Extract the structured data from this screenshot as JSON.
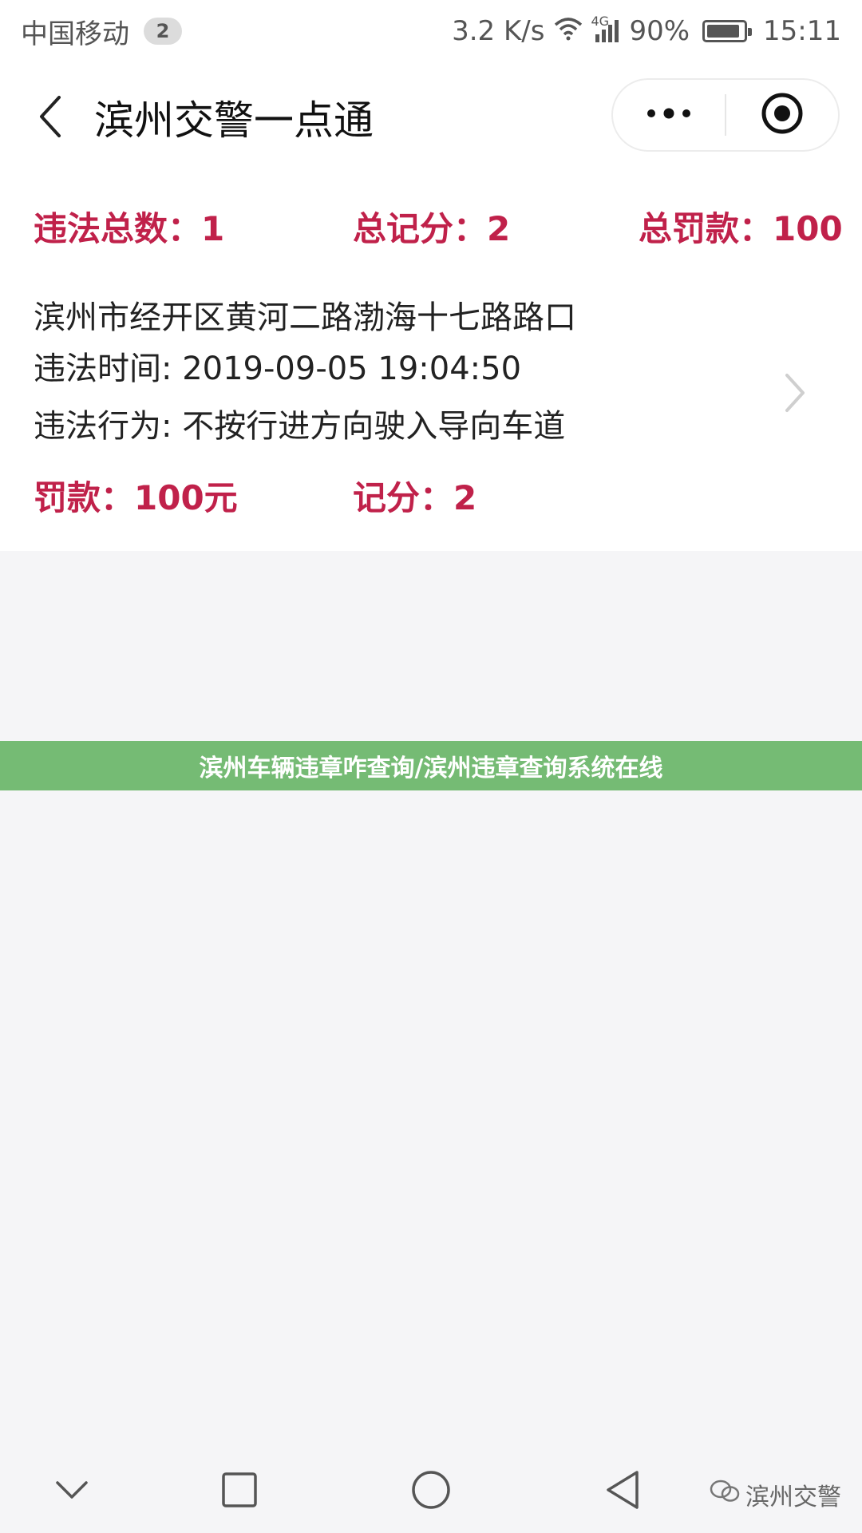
{
  "status_bar": {
    "carrier": "中国移动",
    "sim_badge": "2",
    "net_speed": "3.2 K/s",
    "network_type": "4G",
    "battery": "90%",
    "time": "15:11",
    "battery_level": 0.9
  },
  "header": {
    "title": "滨州交警一点通",
    "back_icon": "chevron-left-icon",
    "more_icon": "more-dots-icon",
    "close_icon": "target-close-icon"
  },
  "summary": {
    "total_violations": "违法总数：1",
    "total_points": "总记分：2",
    "total_fine": "总罚款：100"
  },
  "record": {
    "location": "滨州市经开区黄河二路渤海十七路路口",
    "time": "违法时间: 2019-09-05 19:04:50",
    "behavior": "违法行为: 不按行进方向驶入导向车道",
    "fine": "罚款：100元",
    "points": "记分：2"
  },
  "banner": {
    "text": "滨州车辆违章咋查询/滨州违章查询系统在线"
  },
  "watermark": {
    "text": "滨州交警"
  },
  "colors": {
    "accent_red": "#c0214a",
    "banner_green": "#75bb74",
    "page_bg": "#f5f5f7"
  }
}
